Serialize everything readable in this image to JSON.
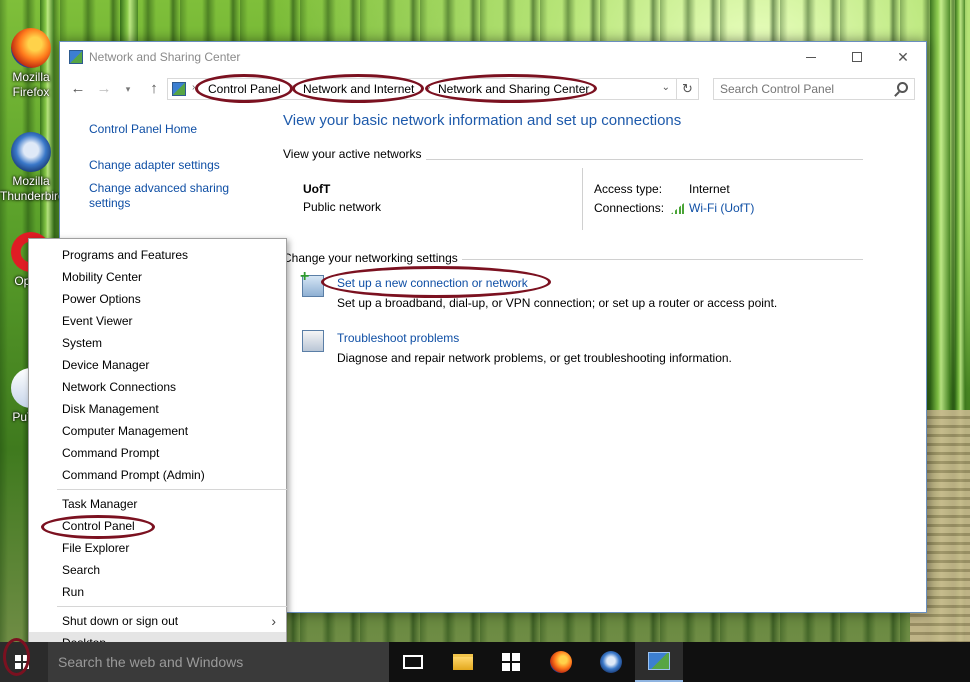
{
  "desktop": {
    "icons": [
      {
        "label": "Mozilla Firefox",
        "icon": "firefox-icon"
      },
      {
        "label": "Mozilla Thunderbird",
        "icon": "thunderbird-icon"
      },
      {
        "label": "Opera",
        "icon": "opera-icon"
      },
      {
        "label": "PuTTY",
        "icon": "putty-icon"
      }
    ]
  },
  "window": {
    "title": "Network and Sharing Center",
    "breadcrumbs": [
      "Control Panel",
      "Network and Internet",
      "Network and Sharing Center"
    ],
    "search_placeholder": "Search Control Panel",
    "left_nav": [
      "Control Panel Home",
      "Change adapter settings",
      "Change advanced sharing settings"
    ],
    "main_title": "View your basic network information and set up connections",
    "active_networks_heading": "View your active networks",
    "network": {
      "name": "UofT",
      "category": "Public network",
      "access_type_label": "Access type:",
      "access_type_value": "Internet",
      "connections_label": "Connections:",
      "connections_value": "Wi-Fi (UofT)"
    },
    "change_settings_heading": "Change your networking settings",
    "tasks": [
      {
        "link": "Set up a new connection or network",
        "description": "Set up a broadband, dial-up, or VPN connection; or set up a router or access point."
      },
      {
        "link": "Troubleshoot problems",
        "description": "Diagnose and repair network problems, or get troubleshooting information."
      }
    ]
  },
  "winx_menu": {
    "group1": [
      "Programs and Features",
      "Mobility Center",
      "Power Options",
      "Event Viewer",
      "System",
      "Device Manager",
      "Network Connections",
      "Disk Management",
      "Computer Management",
      "Command Prompt",
      "Command Prompt (Admin)"
    ],
    "group2": [
      "Task Manager",
      "Control Panel",
      "File Explorer",
      "Search",
      "Run"
    ],
    "group3": [
      "Shut down or sign out",
      "Desktop"
    ],
    "selected": "Desktop"
  },
  "taskbar": {
    "search_placeholder": "Search the web and Windows",
    "apps": [
      "task-view-icon",
      "file-explorer-icon",
      "store-icon",
      "firefox-icon",
      "thunderbird-icon",
      "control-panel-icon"
    ]
  },
  "colors": {
    "annotation_oval": "#7b1120",
    "link": "#0f4fa5",
    "title_blue": "#1e5aab"
  }
}
